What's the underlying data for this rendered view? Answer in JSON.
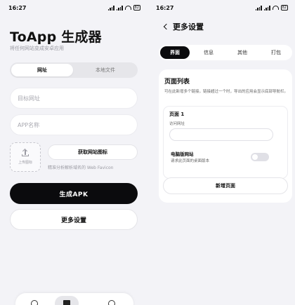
{
  "left": {
    "status": {
      "time": "16:27",
      "battery": "82"
    },
    "title": "ToApp 生成器",
    "subtitle": "将任何网站变成安卓应用",
    "segments": [
      "网址",
      "本地文件"
    ],
    "fields": {
      "target_placeholder": "目标网址",
      "appname_placeholder": "APP名称"
    },
    "upload_label": "上传图标",
    "fetch_button": "获取网站图标",
    "fetch_hint": "精准分析解析域名的 Web Favicon",
    "primary_button": "生成APK",
    "secondary_button": "更多设置"
  },
  "right": {
    "status": {
      "time": "16:27",
      "battery": "82"
    },
    "page_title": "更多设置",
    "tabs": [
      "界面",
      "信息",
      "其他",
      "打包"
    ],
    "card_title": "页面列表",
    "card_desc": "可在此新增多个链接，链接超过一个时，导出的应用会显示底部导航栏。",
    "page_item": {
      "title": "页面 1",
      "url_label": "访问网址",
      "toggle_title": "电脑版网站",
      "toggle_desc": "请求此页面的桌面版本"
    },
    "add_page_button": "新增页面"
  },
  "colors": {
    "accent": "#0b0b0d",
    "background": "#f3f3f7",
    "muted": "#9a9aa2"
  }
}
